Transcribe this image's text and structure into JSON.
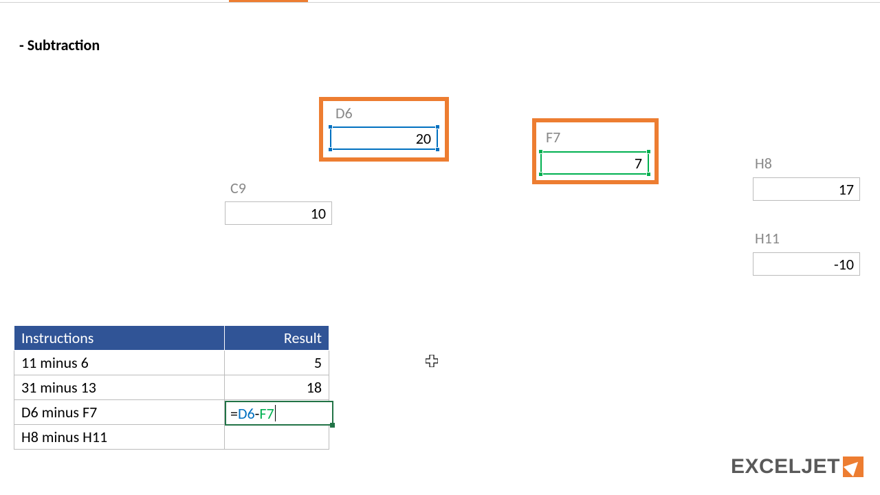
{
  "heading": "- Subtraction",
  "cells": {
    "D6": {
      "label": "D6",
      "value": "20"
    },
    "F7": {
      "label": "F7",
      "value": "7"
    },
    "C9": {
      "label": "C9",
      "value": "10"
    },
    "H8": {
      "label": "H8",
      "value": "17"
    },
    "H11": {
      "label": "H11",
      "value": "-10"
    }
  },
  "table": {
    "headers": {
      "instructions": "Instructions",
      "result": "Result"
    },
    "rows": [
      {
        "instruction": "11 minus 6",
        "result": "5"
      },
      {
        "instruction": "31 minus 13",
        "result": "18"
      },
      {
        "instruction": "D6 minus F7",
        "result": ""
      },
      {
        "instruction": "H8 minus H11",
        "result": ""
      }
    ]
  },
  "formula": {
    "eq": "=",
    "ref1": "D6",
    "op": "-",
    "ref2": "F7"
  },
  "logo": "EXCELJET"
}
